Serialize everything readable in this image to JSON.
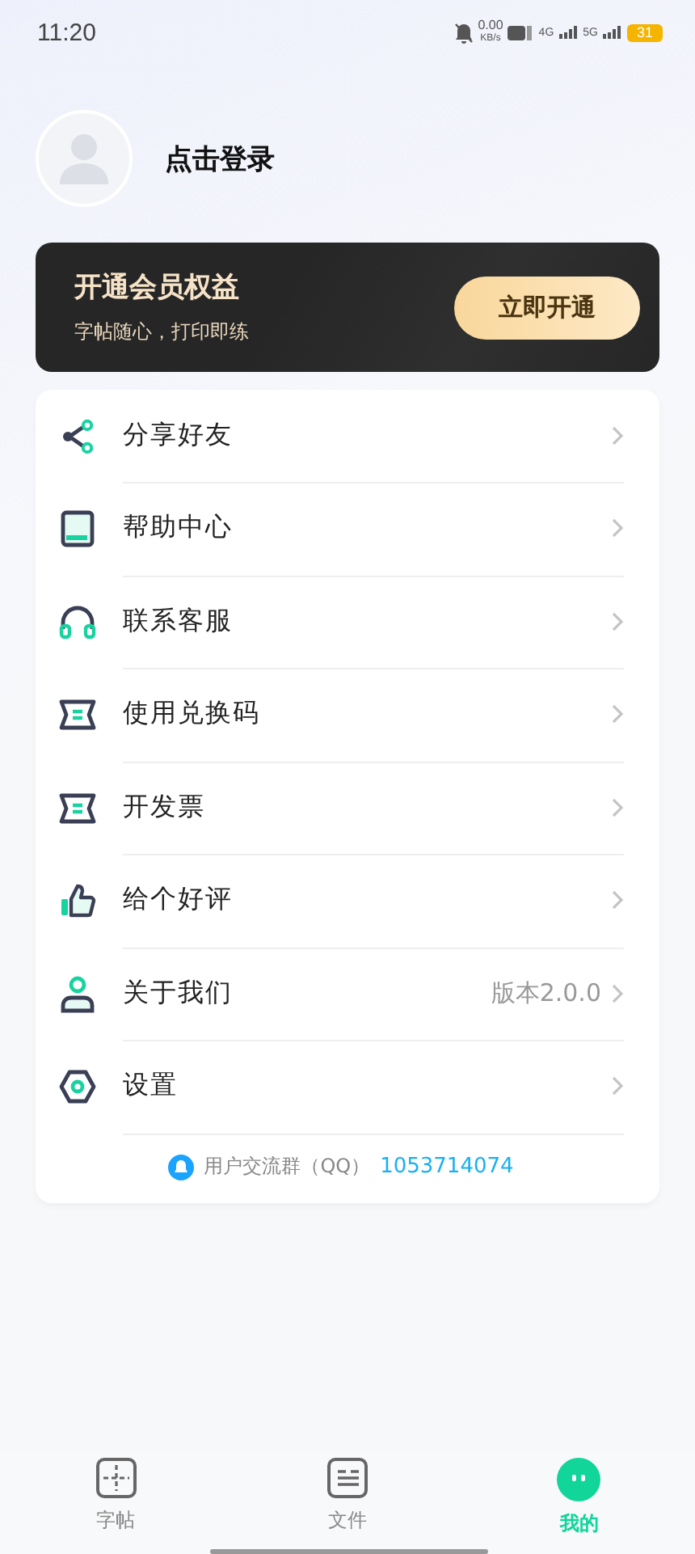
{
  "status_bar": {
    "time": "11:20",
    "speed": "0.00",
    "speed_unit": "KB/s",
    "network_1": "4G",
    "network_2": "5G",
    "battery": "31"
  },
  "profile": {
    "login": "点击登录"
  },
  "vip": {
    "title": "开通会员权益",
    "subtitle": "字帖随心，打印即练",
    "button": "立即开通"
  },
  "menu": [
    {
      "kind": "share",
      "label": "分享好友"
    },
    {
      "kind": "book",
      "label": "帮助中心"
    },
    {
      "kind": "headset",
      "label": "联系客服"
    },
    {
      "kind": "ticket",
      "label": "使用兑换码"
    },
    {
      "kind": "ticket",
      "label": "开发票"
    },
    {
      "kind": "thumb",
      "label": "给个好评"
    },
    {
      "kind": "person",
      "label": "关于我们",
      "value": "版本2.0.0"
    },
    {
      "kind": "hexagon",
      "label": "设置"
    }
  ],
  "group": {
    "label": "用户交流群（QQ）",
    "number": "1053714074"
  },
  "tabs": [
    {
      "kind": "grid",
      "label": "字帖",
      "selected": false
    },
    {
      "kind": "file",
      "label": "文件",
      "selected": false
    },
    {
      "kind": "face",
      "label": "我的",
      "selected": true
    }
  ]
}
